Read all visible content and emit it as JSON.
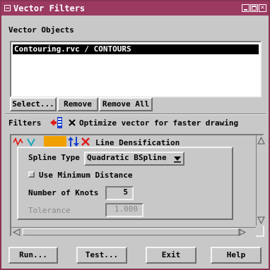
{
  "window": {
    "title": "Vector Filters"
  },
  "vector_objects": {
    "heading": "Vector Objects",
    "items": [
      "Contouring.rvc / CONTOURS"
    ],
    "buttons": {
      "select": "Select...",
      "remove": "Remove",
      "remove_all": "Remove All"
    }
  },
  "filters": {
    "label": "Filters",
    "optimize_label": "Optimize vector for faster drawing",
    "optimize_checked": true,
    "current_filter": "Line Densification",
    "spline_type_label": "Spline Type",
    "spline_type_value": "Quadratic BSpline",
    "use_min_distance_label": "Use Minimum Distance",
    "use_min_distance_checked": false,
    "knots_label": "Number of Knots",
    "knots_value": "5",
    "tolerance_label": "Tolerance",
    "tolerance_value": "1.000"
  },
  "actions": {
    "run": "Run...",
    "test": "Test...",
    "exit": "Exit",
    "help": "Help"
  },
  "colors": {
    "titlebar": "#9b3a60",
    "background": "#c8c8c8",
    "accent_swatch": "#f0a000",
    "arrow_blue": "#1a3fd0",
    "remove_red": "#e01818"
  }
}
